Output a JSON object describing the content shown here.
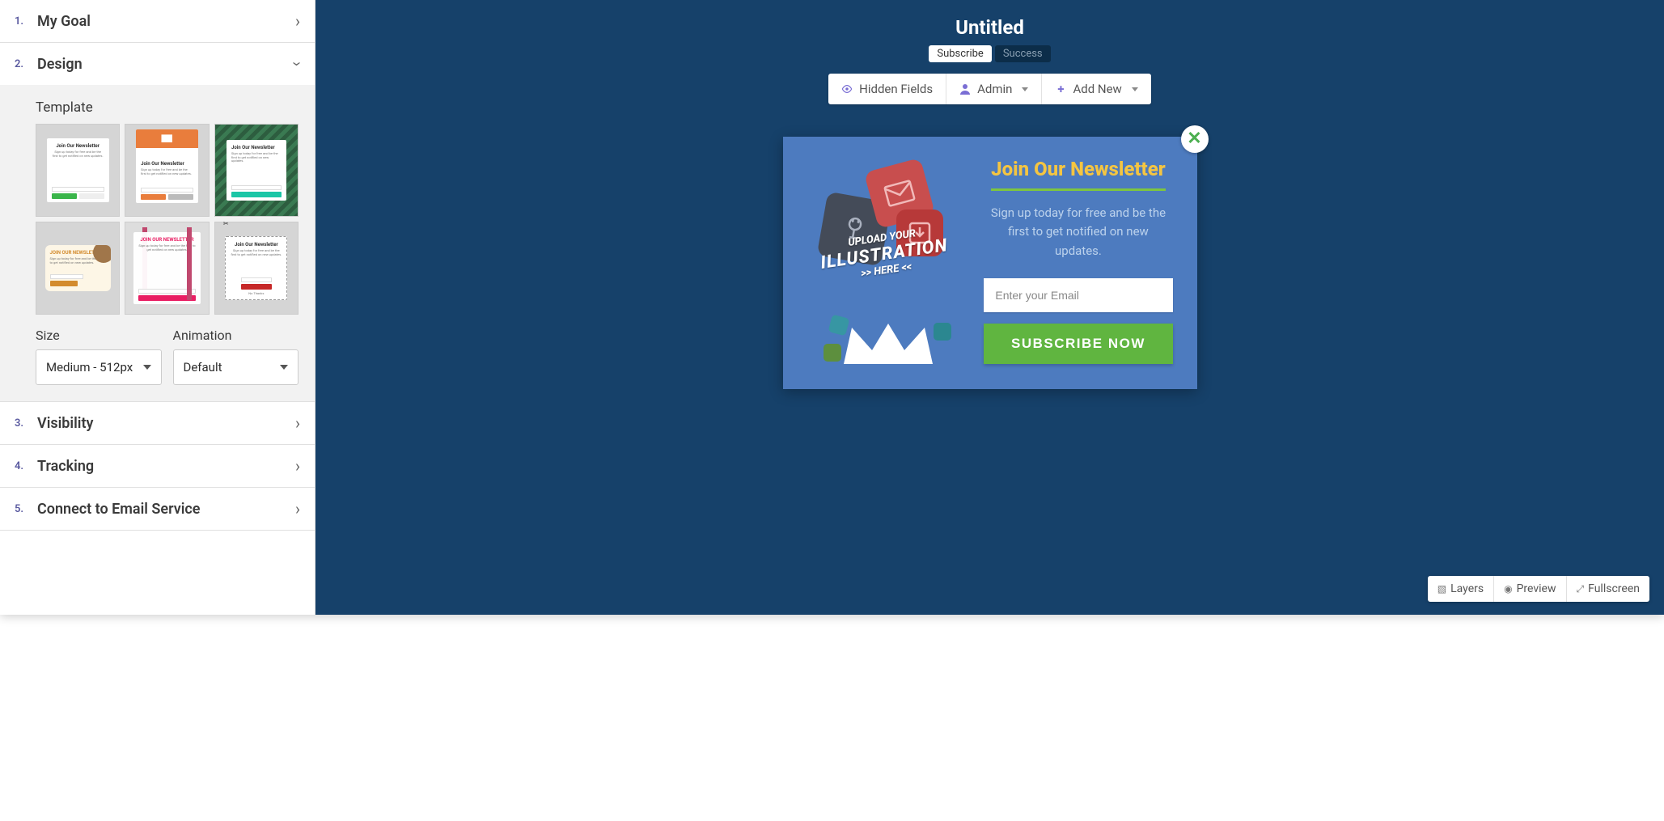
{
  "sidebar": {
    "steps": [
      {
        "num": "1.",
        "title": "My Goal",
        "open": false
      },
      {
        "num": "2.",
        "title": "Design",
        "open": true
      },
      {
        "num": "3.",
        "title": "Visibility",
        "open": false
      },
      {
        "num": "4.",
        "title": "Tracking",
        "open": false
      },
      {
        "num": "5.",
        "title": "Connect to Email Service",
        "open": false
      }
    ],
    "template_label": "Template",
    "size_label": "Size",
    "size_value": "Medium - 512px",
    "animation_label": "Animation",
    "animation_value": "Default"
  },
  "canvas": {
    "title": "Untitled",
    "tabs": {
      "subscribe": "Subscribe",
      "success": "Success"
    },
    "toolbar": {
      "hidden_fields": "Hidden Fields",
      "admin": "Admin",
      "add_new": "Add New"
    },
    "view_tools": {
      "layers": "Layers",
      "preview": "Preview",
      "fullscreen": "Fullscreen"
    }
  },
  "popup": {
    "title": "Join Our Newsletter",
    "description": "Sign up today for free and be the first to get notified on new updates.",
    "email_placeholder": "Enter your Email",
    "button_label": "SUBSCRIBE NOW",
    "illustration": {
      "line1": "UPLOAD YOUR",
      "line2": "ILLUSTRATION",
      "line3": ">> HERE <<"
    }
  },
  "colors": {
    "canvas_bg": "#16416a",
    "popup_bg": "#4d7bbf",
    "accent_yellow": "#f4c542",
    "accent_green": "#60b540"
  }
}
